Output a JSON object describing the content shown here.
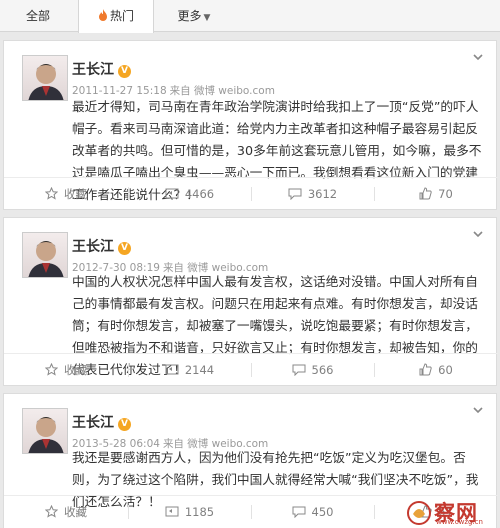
{
  "tabs": [
    {
      "label": "全部"
    },
    {
      "label": "热门"
    },
    {
      "label": "更多"
    }
  ],
  "posts": [
    {
      "author": "王长江",
      "verified_badge": "V",
      "timestamp": "2011-11-27 15:18",
      "source": "来自 微博 weibo.com",
      "text": "最近才得知，司马南在青年政治学院演讲时给我扣上了一顶“反党”的吓人帽子。看来司马南深谙此道：给党内力主改革者扣这种帽子最容易引起反改革者的共鸣。但可惜的是，30多年前这套玩意儿管用，如今嘛，最多不过是嗑瓜子嗑出个臭虫——恶心一下而已。我倒想看看这位新入门的党建工作者还能说什么？！",
      "repost_label": "收藏",
      "repost_count": "4466",
      "comment_count": "3612",
      "like_count": "70"
    },
    {
      "author": "王长江",
      "verified_badge": "V",
      "timestamp": "2012-7-30 08:19",
      "source": "来自 微博 weibo.com",
      "text": "中国的人权状况怎样中国人最有发言权，这话绝对没错。中国人对所有自己的事情都最有发言权。问题只在用起来有点难。有时你想发言，却没话筒；有时你想发言，却被塞了一嘴馒头，说吃饱最要紧；有时你想发言，但唯恐被指为不和谐音，只好欲言又止；有时你想发言，却被告知，你的代表已代你发过了！",
      "repost_label": "收藏",
      "repost_count": "2144",
      "comment_count": "566",
      "like_count": "60"
    },
    {
      "author": "王长江",
      "verified_badge": "V",
      "timestamp": "2013-5-28 06:04",
      "source": "来自 微博 weibo.com",
      "text": "我还是要感谢西方人，因为他们没有抢先把“吃饭”定义为吃汉堡包。否则，为了绕过这个陷阱，我们中国人就得经常大喊“我们坚决不吃饭”，我们还怎么活？！",
      "repost_label": "收藏",
      "repost_count": "1185",
      "comment_count": "450",
      "like_count": "61"
    }
  ],
  "watermark": {
    "text": "察网",
    "url": "www.cwzg.cn"
  },
  "colors": {
    "accent": "#f5a623",
    "brand_red": "#c4392f",
    "hot_tab": "#f07a2c"
  }
}
